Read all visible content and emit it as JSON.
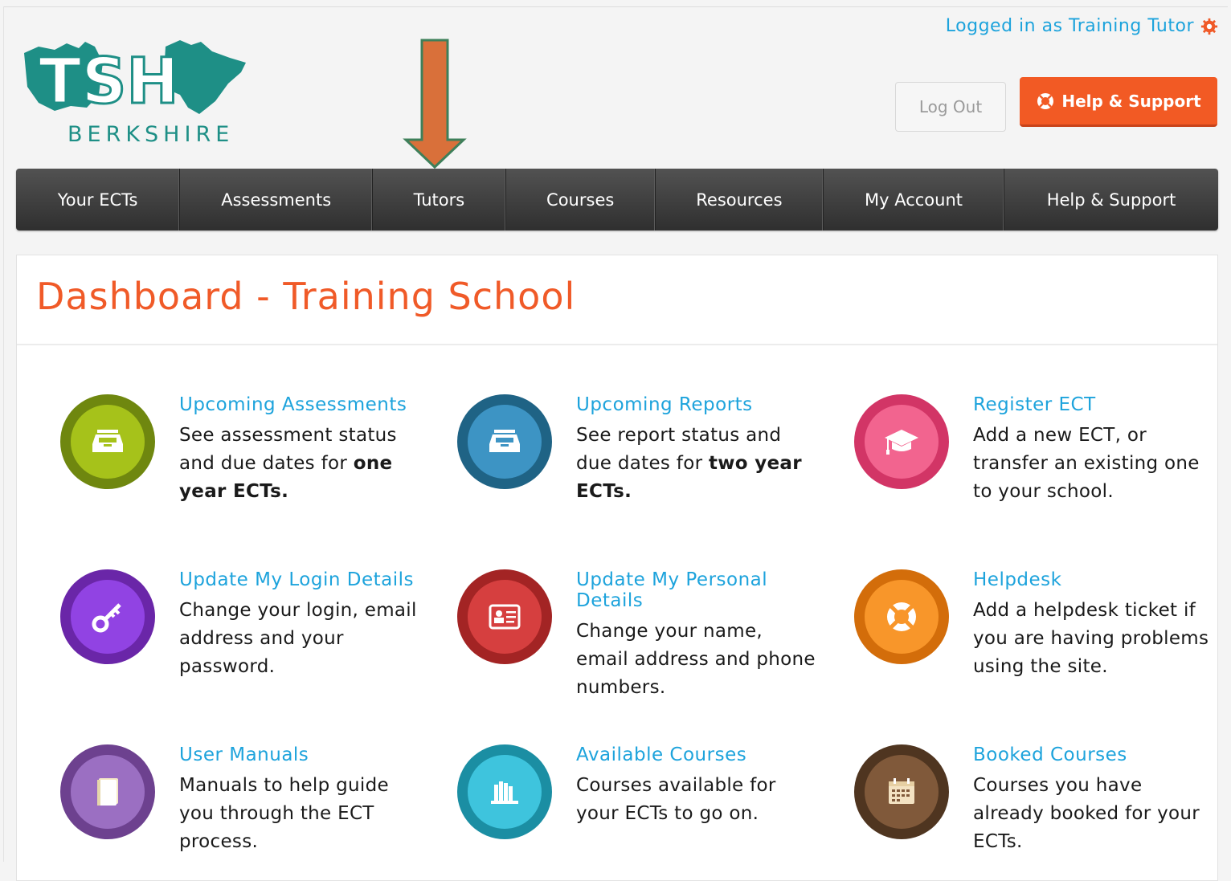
{
  "header": {
    "logo_text": "TSH",
    "logo_subtitle": "BERKSHIRE",
    "logged_in": "Logged in as Training Tutor",
    "logout_label": "Log Out",
    "help_label": "Help & Support"
  },
  "nav": {
    "items": [
      {
        "label": "Your ECTs"
      },
      {
        "label": "Assessments"
      },
      {
        "label": "Tutors"
      },
      {
        "label": "Courses"
      },
      {
        "label": "Resources"
      },
      {
        "label": "My Account"
      },
      {
        "label": "Help & Support"
      }
    ]
  },
  "page": {
    "title": "Dashboard - Training School"
  },
  "tiles": [
    {
      "title": "Upcoming Assessments",
      "desc_pre": "See assessment status and due dates for ",
      "desc_bold": "one year ECTs.",
      "desc_post": "",
      "icon": "inbox-tray-icon",
      "color": "#8ba815"
    },
    {
      "title": "Upcoming Reports",
      "desc_pre": "See report status and due dates for ",
      "desc_bold": "two year ECTs.",
      "desc_post": "",
      "icon": "inbox-tray-icon",
      "color": "#2a7fb0"
    },
    {
      "title": "Register ECT",
      "desc_pre": "Add a new ECT, or transfer an existing one to your school.",
      "desc_bold": "",
      "desc_post": "",
      "icon": "graduation-cap-icon",
      "color": "#ec4a7a"
    },
    {
      "title": "Update My Login Details",
      "desc_pre": "Change your login, email address and your password.",
      "desc_bold": "",
      "desc_post": "",
      "icon": "key-icon",
      "color": "#8b37d6"
    },
    {
      "title": "Update My Personal Details",
      "desc_pre": "Change your name, email address and phone numbers.",
      "desc_bold": "",
      "desc_post": "",
      "icon": "id-card-icon",
      "color": "#cc3333"
    },
    {
      "title": "Helpdesk",
      "desc_pre": "Add a helpdesk ticket if you are having problems using the site.",
      "desc_bold": "",
      "desc_post": "",
      "icon": "lifebuoy-icon",
      "color": "#f58a17"
    },
    {
      "title": "User Manuals",
      "desc_pre": "Manuals to help guide you through the ECT process.",
      "desc_bold": "",
      "desc_post": "",
      "icon": "book-icon",
      "color": "#8e5fb3"
    },
    {
      "title": "Available Courses",
      "desc_pre": "Courses available for your ECTs to go on.",
      "desc_bold": "",
      "desc_post": "",
      "icon": "books-shelf-icon",
      "color": "#25b5d0"
    },
    {
      "title": "Booked Courses",
      "desc_pre": "Courses you have already booked for your ECTs.",
      "desc_bold": "",
      "desc_post": "",
      "icon": "calendar-icon",
      "color": "#6e4a2c"
    }
  ]
}
